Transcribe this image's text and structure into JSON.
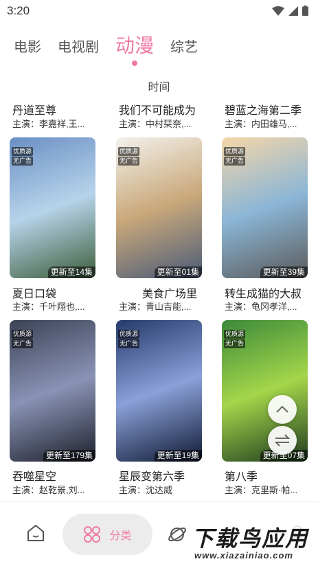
{
  "status_bar": {
    "time": "3:20"
  },
  "tabs": [
    {
      "label": "电影",
      "active": false
    },
    {
      "label": "电视剧",
      "active": false
    },
    {
      "label": "动漫",
      "active": true
    },
    {
      "label": "综艺",
      "active": false
    }
  ],
  "sort_label": "时间",
  "top_row": [
    {
      "title": "丹道至尊",
      "actors": "主演：李嘉祥,王..."
    },
    {
      "title": "我们不可能成为",
      "actors": "主演：中村栞奈,..."
    },
    {
      "title": "碧蓝之海第二季",
      "actors": "主演：内田雄马,..."
    }
  ],
  "cards": [
    {
      "title": "夏日口袋",
      "actors": "主演：千叶翔也,...",
      "badge1": "优质源",
      "badge2": "无广告",
      "update": "更新至14集",
      "colors": [
        "#6a8fc4",
        "#b7d3ea",
        "#3b5e3a"
      ]
    },
    {
      "title": "美食广场里",
      "actors": "主演：青山吉能,...",
      "badge1": "优质源",
      "badge2": "无广告",
      "update": "更新至01集",
      "colors": [
        "#f3f1ec",
        "#c9a87a",
        "#4a5b78"
      ]
    },
    {
      "title": "转生成猫的大叔",
      "actors": "主演：龟冈孝洋,...",
      "badge1": "优质源",
      "badge2": "无广告",
      "update": "更新至39集",
      "colors": [
        "#f5d6a8",
        "#8bb6d6",
        "#5a5a5a"
      ]
    },
    {
      "title": "吞噬星空",
      "actors": "主演：赵乾景,刘...",
      "badge1": "优质源",
      "badge2": "无广告",
      "update": "更新至179集",
      "colors": [
        "#3b4256",
        "#8a93b5",
        "#1c1f2b"
      ]
    },
    {
      "title": "星辰变第六季",
      "actors": "主演：沈达威",
      "badge1": "优质源",
      "badge2": "无广告",
      "update": "更新至19集",
      "colors": [
        "#263a6b",
        "#8aa0d8",
        "#0f1a33"
      ]
    },
    {
      "title": "第八季",
      "actors": "主演：克里斯·帕...",
      "badge1": "优质源",
      "badge2": "无广告",
      "update": "更新至07集",
      "colors": [
        "#3c8a3a",
        "#a4d64a",
        "#1d3a1e"
      ]
    }
  ],
  "bottom_nav": {
    "category_label": "分类"
  },
  "watermark": {
    "main": "下载鸟应用",
    "sub": "www.xiazainiao.com"
  },
  "accent_color": "#f07aa6"
}
